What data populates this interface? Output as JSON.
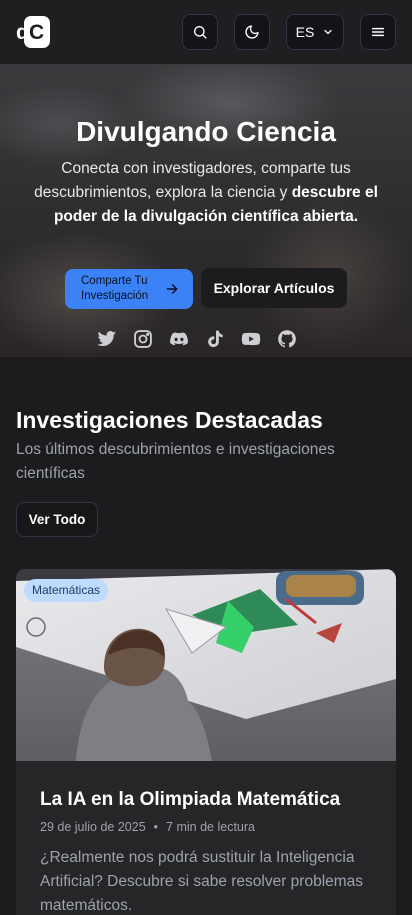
{
  "header": {
    "logo_text_d": "d",
    "logo_text_c": "C",
    "language": "ES",
    "icons": [
      "search-icon",
      "moon-icon",
      "chevron-down-icon",
      "menu-icon"
    ]
  },
  "hero": {
    "title": "Divulgando Ciencia",
    "subtitle_plain": "Conecta con investigadores, comparte tus descubrimientos, explora la ciencia y",
    "subtitle_strong": "descubre el poder de la divulgación científica abierta.",
    "primary_button": "Comparte Tu Investigación",
    "secondary_button": "Explorar Artículos",
    "socials": [
      "twitter-icon",
      "instagram-icon",
      "discord-icon",
      "tiktok-icon",
      "youtube-icon",
      "github-icon"
    ]
  },
  "featured": {
    "title": "Investigaciones Destacadas",
    "subtitle": "Los últimos descubrimientos e investigaciones científicas",
    "view_all": "Ver Todo",
    "cards": [
      {
        "tag": "Matemáticas",
        "title": "La IA en la Olimpiada Matemática",
        "date": "29 de julio de 2025",
        "separator": "•",
        "read_time": "7 min de lectura",
        "description": "¿Realmente nos podrá sustituir la Inteligencia Artificial? Descubre si sabe resolver problemas matemáticos."
      }
    ]
  },
  "colors": {
    "accent": "#3b82f6",
    "background": "#1c1c1e",
    "tag_bg": "#bfdbfe"
  }
}
